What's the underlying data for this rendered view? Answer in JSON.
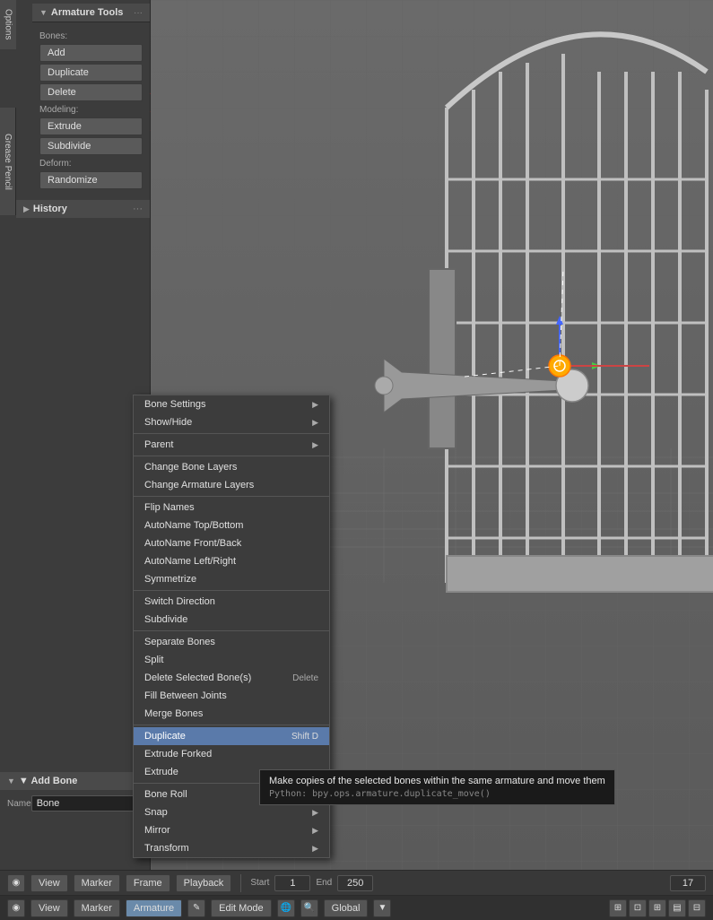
{
  "sidebar": {
    "options_tab": "Options",
    "grease_pencil_tab": "Grease Pencil",
    "armature_tools": {
      "title": "▼ Armature Tools",
      "dots": "···",
      "bones_label": "Bones:",
      "add_btn": "Add",
      "duplicate_btn": "Duplicate",
      "delete_btn": "Delete",
      "modeling_label": "Modeling:",
      "extrude_btn": "Extrude",
      "subdivide_btn": "Subdivide",
      "deform_label": "Deform:",
      "randomize_btn": "Randomize"
    },
    "history": {
      "title": "History",
      "arrow": "▶",
      "dots": "···"
    },
    "add_bone": {
      "title": "▼ Add Bone",
      "name_label": "Name",
      "name_value": "Bone"
    }
  },
  "context_menu": {
    "items": [
      {
        "label": "Bone Settings",
        "hasArrow": true,
        "shortcut": ""
      },
      {
        "label": "Show/Hide",
        "hasArrow": true,
        "shortcut": ""
      },
      {
        "label": "",
        "separator": true
      },
      {
        "label": "Parent",
        "hasArrow": true,
        "shortcut": ""
      },
      {
        "label": "",
        "separator": true
      },
      {
        "label": "Change Bone Layers",
        "hasArrow": false,
        "shortcut": ""
      },
      {
        "label": "Change Armature Layers",
        "hasArrow": false,
        "shortcut": ""
      },
      {
        "label": "",
        "separator": true
      },
      {
        "label": "Flip Names",
        "hasArrow": false,
        "shortcut": ""
      },
      {
        "label": "AutoName Top/Bottom",
        "hasArrow": false,
        "shortcut": ""
      },
      {
        "label": "AutoName Front/Back",
        "hasArrow": false,
        "shortcut": ""
      },
      {
        "label": "AutoName Left/Right",
        "hasArrow": false,
        "shortcut": ""
      },
      {
        "label": "Symmetrize",
        "hasArrow": false,
        "shortcut": ""
      },
      {
        "label": "",
        "separator": true
      },
      {
        "label": "Switch Direction",
        "hasArrow": false,
        "shortcut": ""
      },
      {
        "label": "Subdivide",
        "hasArrow": false,
        "shortcut": ""
      },
      {
        "label": "",
        "separator": true
      },
      {
        "label": "Separate Bones",
        "hasArrow": false,
        "shortcut": ""
      },
      {
        "label": "Split",
        "hasArrow": false,
        "shortcut": ""
      },
      {
        "label": "Delete Selected Bone(s)",
        "hasArrow": false,
        "shortcut": "Delete"
      },
      {
        "label": "Fill Between Joints",
        "hasArrow": false,
        "shortcut": ""
      },
      {
        "label": "Merge Bones",
        "hasArrow": false,
        "shortcut": ""
      },
      {
        "label": "",
        "separator": true
      },
      {
        "label": "Duplicate",
        "hasArrow": false,
        "shortcut": "Shift D",
        "highlighted": true
      },
      {
        "label": "Extrude Forked",
        "hasArrow": false,
        "shortcut": ""
      },
      {
        "label": "Extrude",
        "hasArrow": false,
        "shortcut": ""
      },
      {
        "label": "",
        "separator": true
      },
      {
        "label": "Bone Roll",
        "hasArrow": false,
        "shortcut": ""
      },
      {
        "label": "Snap",
        "hasArrow": true,
        "shortcut": ""
      },
      {
        "label": "Mirror",
        "hasArrow": true,
        "shortcut": ""
      },
      {
        "label": "Transform",
        "hasArrow": true,
        "shortcut": ""
      }
    ]
  },
  "tooltip": {
    "title": "Make copies of the selected bones within the same armature and move them",
    "python": "Python: bpy.ops.armature.duplicate_move()"
  },
  "status_bar": {
    "row1": {
      "view_btn": "View",
      "marker_btn": "Marker",
      "frame_btn": "Frame",
      "playback_btn": "Playback",
      "start_label": "Start",
      "start_value": "1",
      "end_label": "End",
      "end_value": "250",
      "current_label": "",
      "current_value": "17"
    },
    "row2": {
      "icon_btn": "◉",
      "view_btn": "View",
      "marker_btn": "Marker",
      "mode_btn": "Edit Mode",
      "armature_btn": "Armature",
      "global_btn": "Global",
      "icons_right": [
        "⊞",
        "⊞",
        "⊞",
        "⊞",
        "⊞"
      ]
    }
  }
}
